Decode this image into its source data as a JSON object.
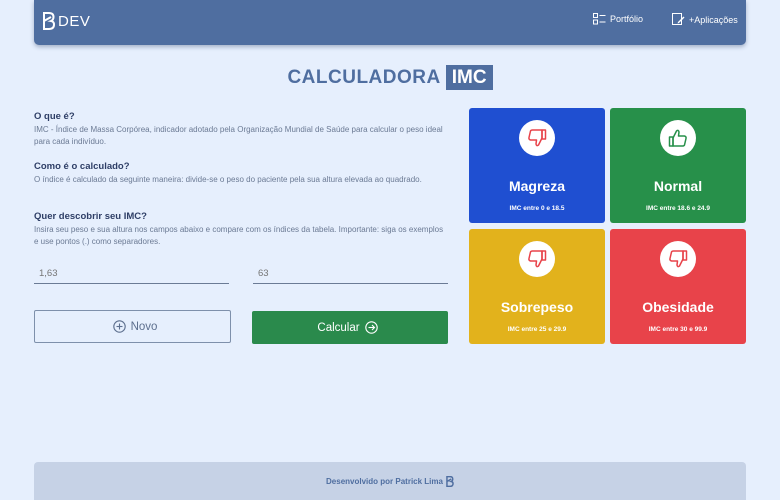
{
  "navbar": {
    "logo_text": "DEV",
    "links": [
      {
        "label": "Portfólio",
        "icon": "portfolio-icon"
      },
      {
        "label": "+Aplicações",
        "icon": "apps-icon"
      }
    ]
  },
  "title": {
    "main": "CALCULADORA",
    "highlight": "IMC"
  },
  "info": [
    {
      "heading": "O que é?",
      "text": "IMC - Índice de Massa Corpórea, indicador adotado pela Organização Mundial de Saúde para calcular o peso ideal para cada indivíduo."
    },
    {
      "heading": "Como é o calculado?",
      "text": "O índice é calculado da seguinte maneira: divide-se o peso do paciente pela sua altura elevada ao quadrado."
    },
    {
      "heading": "Quer descobrir seu IMC?",
      "text": "Insira seu peso e sua altura nos campos abaixo e compare com os índices da tabela. Importante: siga os exemplos e use pontos (.) como separadores."
    }
  ],
  "form": {
    "height_placeholder": "1,63",
    "weight_placeholder": "63",
    "novo_label": "Novo",
    "calcular_label": "Calcular"
  },
  "cards": [
    {
      "name": "Magreza",
      "range": "IMC entre 0 e 18.5",
      "color": "#1f4fd1",
      "icon": "thumbs-down-icon"
    },
    {
      "name": "Normal",
      "range": "IMC entre 18.6 e 24.9",
      "color": "#27904a",
      "icon": "thumbs-up-icon"
    },
    {
      "name": "Sobrepeso",
      "range": "IMC entre 25 e 29.9",
      "color": "#e2b21c",
      "icon": "thumbs-down-icon"
    },
    {
      "name": "Obesidade",
      "range": "IMC entre 30 e 99.9",
      "color": "#e8434a",
      "icon": "thumbs-down-icon"
    }
  ],
  "footer": {
    "text": "Desenvolvido por Patrick Lima"
  }
}
